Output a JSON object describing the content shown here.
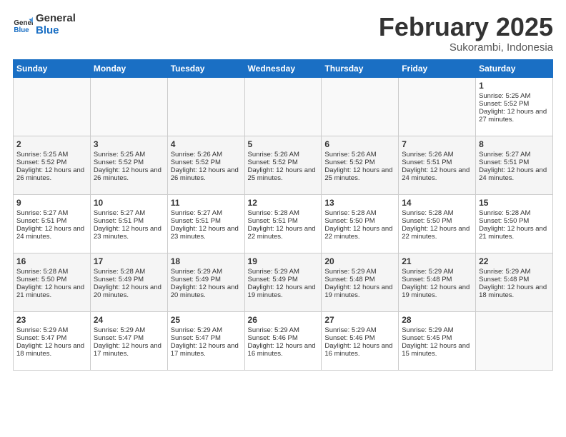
{
  "logo": {
    "line1": "General",
    "line2": "Blue"
  },
  "title": "February 2025",
  "subtitle": "Sukorambi, Indonesia",
  "days_of_week": [
    "Sunday",
    "Monday",
    "Tuesday",
    "Wednesday",
    "Thursday",
    "Friday",
    "Saturday"
  ],
  "weeks": [
    [
      {
        "day": "",
        "empty": true
      },
      {
        "day": "",
        "empty": true
      },
      {
        "day": "",
        "empty": true
      },
      {
        "day": "",
        "empty": true
      },
      {
        "day": "",
        "empty": true
      },
      {
        "day": "",
        "empty": true
      },
      {
        "day": "1",
        "sunrise": "5:25 AM",
        "sunset": "5:52 PM",
        "daylight": "12 hours and 27 minutes."
      }
    ],
    [
      {
        "day": "2",
        "sunrise": "5:25 AM",
        "sunset": "5:52 PM",
        "daylight": "12 hours and 26 minutes."
      },
      {
        "day": "3",
        "sunrise": "5:25 AM",
        "sunset": "5:52 PM",
        "daylight": "12 hours and 26 minutes."
      },
      {
        "day": "4",
        "sunrise": "5:26 AM",
        "sunset": "5:52 PM",
        "daylight": "12 hours and 26 minutes."
      },
      {
        "day": "5",
        "sunrise": "5:26 AM",
        "sunset": "5:52 PM",
        "daylight": "12 hours and 25 minutes."
      },
      {
        "day": "6",
        "sunrise": "5:26 AM",
        "sunset": "5:52 PM",
        "daylight": "12 hours and 25 minutes."
      },
      {
        "day": "7",
        "sunrise": "5:26 AM",
        "sunset": "5:51 PM",
        "daylight": "12 hours and 24 minutes."
      },
      {
        "day": "8",
        "sunrise": "5:27 AM",
        "sunset": "5:51 PM",
        "daylight": "12 hours and 24 minutes."
      }
    ],
    [
      {
        "day": "9",
        "sunrise": "5:27 AM",
        "sunset": "5:51 PM",
        "daylight": "12 hours and 24 minutes."
      },
      {
        "day": "10",
        "sunrise": "5:27 AM",
        "sunset": "5:51 PM",
        "daylight": "12 hours and 23 minutes."
      },
      {
        "day": "11",
        "sunrise": "5:27 AM",
        "sunset": "5:51 PM",
        "daylight": "12 hours and 23 minutes."
      },
      {
        "day": "12",
        "sunrise": "5:28 AM",
        "sunset": "5:51 PM",
        "daylight": "12 hours and 22 minutes."
      },
      {
        "day": "13",
        "sunrise": "5:28 AM",
        "sunset": "5:50 PM",
        "daylight": "12 hours and 22 minutes."
      },
      {
        "day": "14",
        "sunrise": "5:28 AM",
        "sunset": "5:50 PM",
        "daylight": "12 hours and 22 minutes."
      },
      {
        "day": "15",
        "sunrise": "5:28 AM",
        "sunset": "5:50 PM",
        "daylight": "12 hours and 21 minutes."
      }
    ],
    [
      {
        "day": "16",
        "sunrise": "5:28 AM",
        "sunset": "5:50 PM",
        "daylight": "12 hours and 21 minutes."
      },
      {
        "day": "17",
        "sunrise": "5:28 AM",
        "sunset": "5:49 PM",
        "daylight": "12 hours and 20 minutes."
      },
      {
        "day": "18",
        "sunrise": "5:29 AM",
        "sunset": "5:49 PM",
        "daylight": "12 hours and 20 minutes."
      },
      {
        "day": "19",
        "sunrise": "5:29 AM",
        "sunset": "5:49 PM",
        "daylight": "12 hours and 19 minutes."
      },
      {
        "day": "20",
        "sunrise": "5:29 AM",
        "sunset": "5:48 PM",
        "daylight": "12 hours and 19 minutes."
      },
      {
        "day": "21",
        "sunrise": "5:29 AM",
        "sunset": "5:48 PM",
        "daylight": "12 hours and 19 minutes."
      },
      {
        "day": "22",
        "sunrise": "5:29 AM",
        "sunset": "5:48 PM",
        "daylight": "12 hours and 18 minutes."
      }
    ],
    [
      {
        "day": "23",
        "sunrise": "5:29 AM",
        "sunset": "5:47 PM",
        "daylight": "12 hours and 18 minutes."
      },
      {
        "day": "24",
        "sunrise": "5:29 AM",
        "sunset": "5:47 PM",
        "daylight": "12 hours and 17 minutes."
      },
      {
        "day": "25",
        "sunrise": "5:29 AM",
        "sunset": "5:47 PM",
        "daylight": "12 hours and 17 minutes."
      },
      {
        "day": "26",
        "sunrise": "5:29 AM",
        "sunset": "5:46 PM",
        "daylight": "12 hours and 16 minutes."
      },
      {
        "day": "27",
        "sunrise": "5:29 AM",
        "sunset": "5:46 PM",
        "daylight": "12 hours and 16 minutes."
      },
      {
        "day": "28",
        "sunrise": "5:29 AM",
        "sunset": "5:45 PM",
        "daylight": "12 hours and 15 minutes."
      },
      {
        "day": "",
        "empty": true
      }
    ]
  ]
}
